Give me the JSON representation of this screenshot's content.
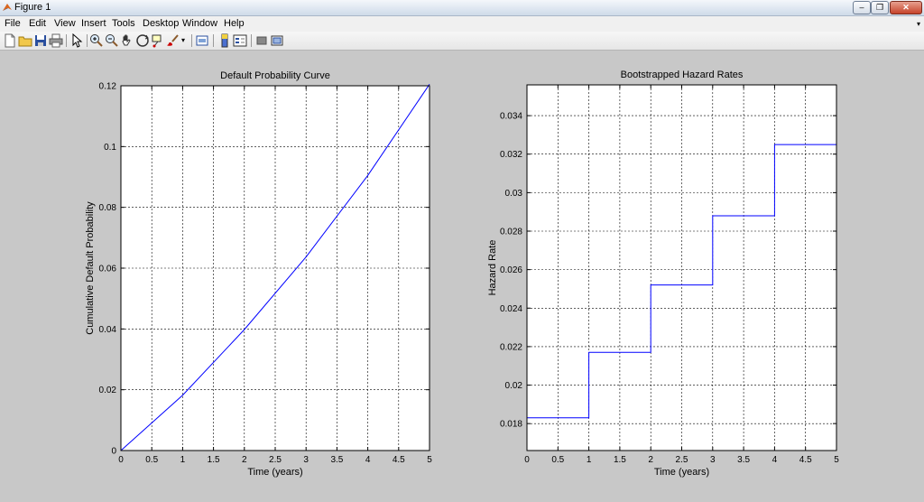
{
  "window": {
    "title": "Figure 1"
  },
  "menu": [
    "File",
    "Edit",
    "View",
    "Insert",
    "Tools",
    "Desktop",
    "Window",
    "Help"
  ],
  "toolbar": {
    "icons": [
      "new-figure-icon",
      "open-file-icon",
      "save-icon",
      "print-icon",
      "pointer-icon",
      "zoom-in-icon",
      "zoom-out-icon",
      "pan-icon",
      "rotate-3d-icon",
      "data-cursor-icon",
      "brush-icon",
      "link-plot-icon",
      "colorbar-icon",
      "legend-icon",
      "hide-plot-tools-icon",
      "show-plot-tools-icon"
    ]
  },
  "chart_data": [
    {
      "type": "line",
      "title": "Default Probability Curve",
      "xlabel": "Time (years)",
      "ylabel": "Cumulative Default Probability",
      "xlim": [
        0,
        5
      ],
      "ylim": [
        0,
        0.12
      ],
      "xticks": [
        "0",
        "0.5",
        "1",
        "1.5",
        "2",
        "2.5",
        "3",
        "3.5",
        "4",
        "4.5",
        "5"
      ],
      "yticks": [
        "0",
        "0.02",
        "0.04",
        "0.06",
        "0.08",
        "0.1",
        "0.12"
      ],
      "grid": true,
      "color": "#0000ff",
      "x": [
        0,
        1,
        2,
        3,
        4,
        5
      ],
      "y": [
        0,
        0.0182,
        0.0398,
        0.0637,
        0.0905,
        0.1205
      ]
    },
    {
      "type": "line",
      "title": "Bootstrapped Hazard Rates",
      "xlabel": "Time (years)",
      "ylabel": "Hazard Rate",
      "xlim": [
        0,
        5
      ],
      "ylim": [
        0.0166,
        0.0356
      ],
      "xticks": [
        "0",
        "0.5",
        "1",
        "1.5",
        "2",
        "2.5",
        "3",
        "3.5",
        "4",
        "4.5",
        "5"
      ],
      "yticks": [
        "0.018",
        "0.02",
        "0.022",
        "0.024",
        "0.026",
        "0.028",
        "0.03",
        "0.032",
        "0.034"
      ],
      "grid": true,
      "color": "#0000ff",
      "step": true,
      "x": [
        0,
        1,
        1,
        2,
        2,
        3,
        3,
        4,
        4,
        5
      ],
      "y": [
        0.0183,
        0.0183,
        0.0217,
        0.0217,
        0.0252,
        0.0252,
        0.0288,
        0.0288,
        0.0325,
        0.0325
      ]
    }
  ]
}
